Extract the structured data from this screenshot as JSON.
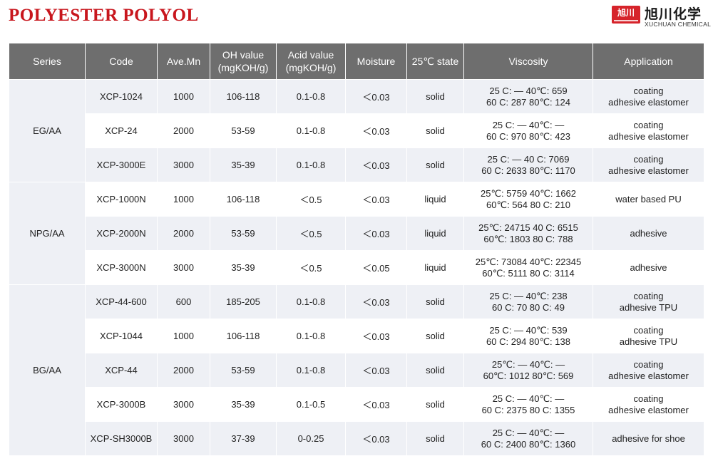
{
  "title": "POLYESTER POLYOL",
  "brand": {
    "mark_text": "旭川",
    "name_cn": "旭川化学",
    "name_en": "XUCHUAN CHEMICAL",
    "mark_color": "#d6242b"
  },
  "colors": {
    "title": "#c8161d",
    "header_bg": "#6e6e6e",
    "band_bg": "#eef0f5"
  },
  "table": {
    "headers": {
      "series": "Series",
      "code": "Code",
      "mn": "Ave.Mn",
      "oh_line1": "OH value",
      "oh_line2": "(mgKOH/g)",
      "acid_line1": "Acid value",
      "acid_line2": "(mgKOH/g)",
      "moisture": "Moisture",
      "state": "25℃ state",
      "viscosity": "Viscosity",
      "application": "Application"
    },
    "groups": [
      {
        "series": "EG/AA",
        "rows": [
          {
            "code": "XCP-1024",
            "mn": "1000",
            "oh": "106-118",
            "acid": "0.1-0.8",
            "moisture": "＜0.03",
            "state": "solid",
            "visc1": "25 C: —    40℃: 659",
            "visc2": "60 C: 287  80℃: 124",
            "app1": "coating",
            "app2": "adhesive elastomer"
          },
          {
            "code": "XCP-24",
            "mn": "2000",
            "oh": "53-59",
            "acid": "0.1-0.8",
            "moisture": "＜0.03",
            "state": "solid",
            "visc1": "25 C: —    40℃: —",
            "visc2": "60 C: 970  80℃: 423",
            "app1": "coating",
            "app2": "adhesive elastomer"
          },
          {
            "code": "XCP-3000E",
            "mn": "3000",
            "oh": "35-39",
            "acid": "0.1-0.8",
            "moisture": "＜0.03",
            "state": "solid",
            "visc1": "25 C: —     40 C: 7069",
            "visc2": "60 C: 2633  80℃: 1170",
            "app1": "coating",
            "app2": "adhesive elastomer"
          }
        ]
      },
      {
        "series": "NPG/AA",
        "rows": [
          {
            "code": "XCP-1000N",
            "mn": "1000",
            "oh": "106-118",
            "acid": "＜0.5",
            "moisture": "＜0.03",
            "state": "liquid",
            "visc1": "25℃: 5759 40℃: 1662",
            "visc2": "60℃: 564   80 C: 210",
            "app1": "water based PU",
            "app2": ""
          },
          {
            "code": "XCP-2000N",
            "mn": "2000",
            "oh": "53-59",
            "acid": "＜0.5",
            "moisture": "＜0.03",
            "state": "liquid",
            "visc1": "25℃: 24715  40 C: 6515",
            "visc2": "60℃: 1803   80 C: 788",
            "app1": "adhesive",
            "app2": ""
          },
          {
            "code": "XCP-3000N",
            "mn": "3000",
            "oh": "35-39",
            "acid": "＜0.5",
            "moisture": "＜0.05",
            "state": "liquid",
            "visc1": "25℃: 73084  40℃: 22345",
            "visc2": "60℃: 5111   80 C: 3114",
            "app1": "adhesive",
            "app2": ""
          }
        ]
      },
      {
        "series": "BG/AA",
        "rows": [
          {
            "code": "XCP-44-600",
            "mn": "600",
            "oh": "185-205",
            "acid": "0.1-0.8",
            "moisture": "＜0.03",
            "state": "solid",
            "visc1": "25 C: —    40℃: 238",
            "visc2": "60 C: 70    80 C: 49",
            "app1": "coating",
            "app2": "adhesive TPU"
          },
          {
            "code": "XCP-1044",
            "mn": "1000",
            "oh": "106-118",
            "acid": "0.1-0.8",
            "moisture": "＜0.03",
            "state": "solid",
            "visc1": "25 C: —    40℃: 539",
            "visc2": "60 C: 294  80℃: 138",
            "app1": "coating",
            "app2": "adhesive TPU"
          },
          {
            "code": "XCP-44",
            "mn": "2000",
            "oh": "53-59",
            "acid": "0.1-0.8",
            "moisture": "＜0.03",
            "state": "solid",
            "visc1": "25℃: —     40℃: —",
            "visc2": "60℃: 1012  80℃: 569",
            "app1": "coating",
            "app2": "adhesive elastomer"
          },
          {
            "code": "XCP-3000B",
            "mn": "3000",
            "oh": "35-39",
            "acid": "0.1-0.5",
            "moisture": "＜0.03",
            "state": "solid",
            "visc1": "25 C:  —     40℃: —",
            "visc2": "60 C: 2375  80 C: 1355",
            "app1": "coating",
            "app2": "adhesive elastomer"
          },
          {
            "code": "XCP-SH3000B",
            "mn": "3000",
            "oh": "37-39",
            "acid": "0-0.25",
            "moisture": "＜0.03",
            "state": "solid",
            "visc1": "25 C: —     40℃: —",
            "visc2": "60 C: 2400  80℃: 1360",
            "app1": "adhesive for shoe",
            "app2": ""
          }
        ]
      }
    ]
  }
}
